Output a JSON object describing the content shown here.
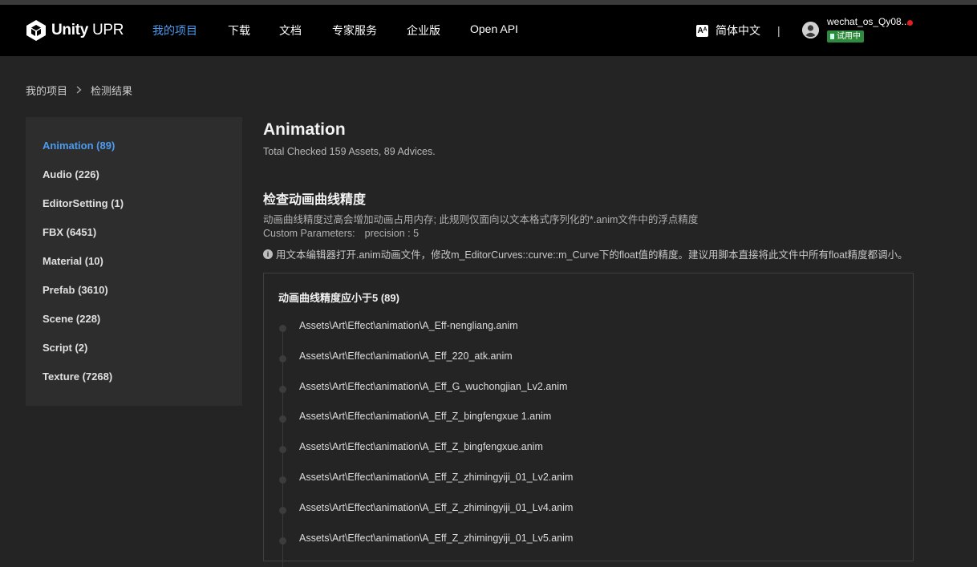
{
  "header": {
    "brand_main": "Unity",
    "brand_suffix": "UPR",
    "nav": [
      {
        "label": "我的项目"
      },
      {
        "label": "下载"
      },
      {
        "label": "文档"
      },
      {
        "label": "专家服务"
      },
      {
        "label": "企业版"
      },
      {
        "label": "Open API"
      }
    ],
    "active_nav": "我的项目",
    "language_icon": "Aᴬ",
    "language": "简体中文",
    "divider": "|",
    "user_name": "wechat_os_Qy08...",
    "trial_badge": "试用中"
  },
  "breadcrumb": {
    "root": "我的项目",
    "current": "检测结果"
  },
  "sidebar": {
    "items": [
      {
        "label": "Animation (89)"
      },
      {
        "label": "Audio (226)"
      },
      {
        "label": "EditorSetting (1)"
      },
      {
        "label": "FBX (6451)"
      },
      {
        "label": "Material (10)"
      },
      {
        "label": "Prefab (3610)"
      },
      {
        "label": "Scene (228)"
      },
      {
        "label": "Script (2)"
      },
      {
        "label": "Texture (7268)"
      }
    ],
    "active": "Animation (89)"
  },
  "main": {
    "title": "Animation",
    "subtitle": "Total Checked 159 Assets, 89 Advices.",
    "rule": {
      "title": "检查动画曲线精度",
      "description": "动画曲线精度过高会增加动画占用内存; 此规则仅面向以文本格式序列化的*.anim文件中的浮点精度",
      "params_label": "Custom Parameters:",
      "params_value": "precision : 5",
      "tip": "用文本编辑器打开.anim动画文件，修改m_EditorCurves::curve::m_Curve下的float值的精度。建议用脚本直接将此文件中所有float精度都调小。"
    },
    "results": {
      "title": "动画曲线精度应小于5 (89)",
      "files": [
        "Assets\\Art\\Effect\\animation\\A_Eff-nengliang.anim",
        "Assets\\Art\\Effect\\animation\\A_Eff_220_atk.anim",
        "Assets\\Art\\Effect\\animation\\A_Eff_G_wuchongjian_Lv2.anim",
        "Assets\\Art\\Effect\\animation\\A_Eff_Z_bingfengxue 1.anim",
        "Assets\\Art\\Effect\\animation\\A_Eff_Z_bingfengxue.anim",
        "Assets\\Art\\Effect\\animation\\A_Eff_Z_zhimingyiji_01_Lv2.anim",
        "Assets\\Art\\Effect\\animation\\A_Eff_Z_zhimingyiji_01_Lv4.anim",
        "Assets\\Art\\Effect\\animation\\A_Eff_Z_zhimingyiji_01_Lv5.anim"
      ]
    }
  },
  "colors": {
    "accent": "#4c9bf0",
    "navbar_bg": "#000000",
    "page_bg": "#242424",
    "sidebar_bg": "#2d2d2d",
    "trial_badge": "#2e8b3e",
    "notification_dot": "#e02020"
  }
}
